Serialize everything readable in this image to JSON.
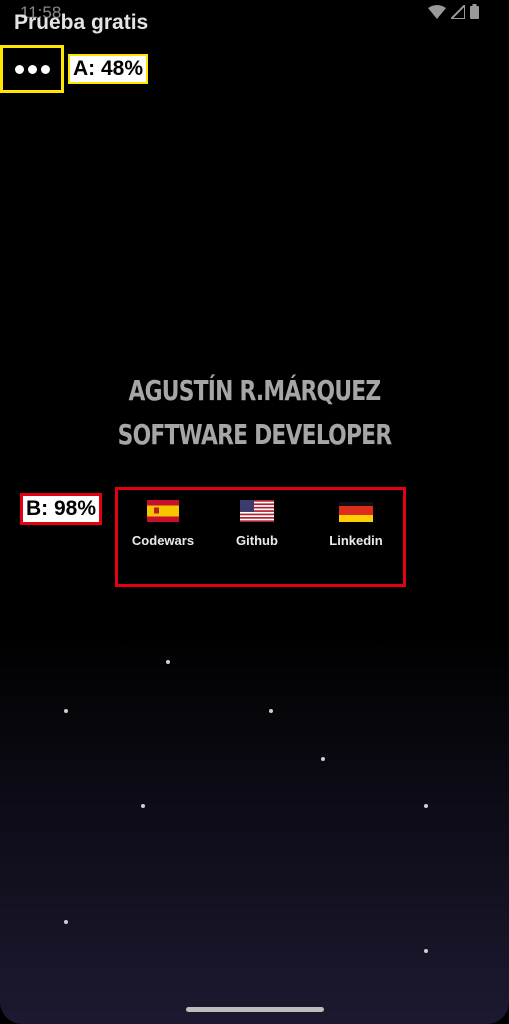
{
  "status_bar": {
    "time": "11:58",
    "icons": [
      "wifi-icon",
      "signal-icon",
      "battery-icon"
    ]
  },
  "app": {
    "title": "Prueba gratis"
  },
  "overlay_labels": {
    "a": "A: 48%",
    "b": "B: 98%"
  },
  "hero": {
    "name": "AGUSTÍN R.MÁRQUEZ",
    "role": "SOFTWARE DEVELOPER"
  },
  "links": [
    {
      "label": "Codewars",
      "icon": "spain-flag-icon"
    },
    {
      "label": "Github",
      "icon": "usa-flag-icon"
    },
    {
      "label": "Linkedin",
      "icon": "germany-flag-icon"
    }
  ],
  "colors": {
    "highlight_yellow": "#ffe600",
    "highlight_red": "#e3000f",
    "background": "#000000"
  }
}
